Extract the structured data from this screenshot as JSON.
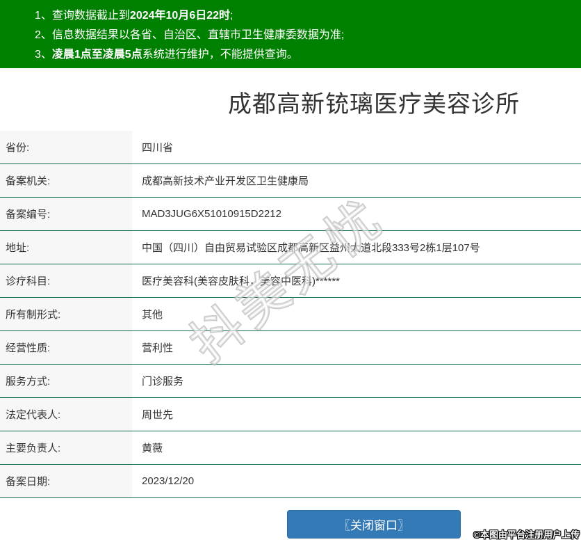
{
  "notice": {
    "line1": {
      "num": "1、",
      "pre": "查询数据截止到",
      "bold": "2024年10月6日22时",
      "post": ";"
    },
    "line2": {
      "num": "2、",
      "pre": "信息数据结果以各省、自治区、直辖市卫生健康委数据为准;",
      "bold": "",
      "post": ""
    },
    "line3": {
      "num": "3、",
      "pre": "",
      "bold": "凌晨1点至凌晨5点",
      "post": "系统进行维护，不能提供查询。"
    }
  },
  "title": "成都高新铳璃医疗美容诊所",
  "table": {
    "rows": [
      {
        "label": "省份:",
        "value": "四川省"
      },
      {
        "label": "备案机关:",
        "value": "成都高新技术产业开发区卫生健康局"
      },
      {
        "label": "备案编号:",
        "value": "MAD3JUG6X51010915D2212"
      },
      {
        "label": "地址:",
        "value": "中国（四川）自由贸易试验区成都高新区益州大道北段333号2栋1层107号"
      },
      {
        "label": "诊疗科目:",
        "value": "医疗美容科(美容皮肤科，美容中医科)******"
      },
      {
        "label": "所有制形式:",
        "value": "其他"
      },
      {
        "label": "经营性质:",
        "value": "营利性"
      },
      {
        "label": "服务方式:",
        "value": "门诊服务"
      },
      {
        "label": "法定代表人:",
        "value": "周世先"
      },
      {
        "label": "主要负责人:",
        "value": "黄薇"
      },
      {
        "label": "备案日期:",
        "value": "2023/12/20"
      }
    ]
  },
  "close_button": {
    "label": "〖关闭窗口〗"
  },
  "watermark": {
    "text": "抖美无忧"
  },
  "attribution": {
    "text": "©本图由平台注册用户上传"
  },
  "colors": {
    "banner_green": "#008000",
    "row_divider_green": "#0d6a41",
    "label_bg": "#f7f7f7",
    "button_blue": "#337ab7",
    "text": "#333333"
  }
}
